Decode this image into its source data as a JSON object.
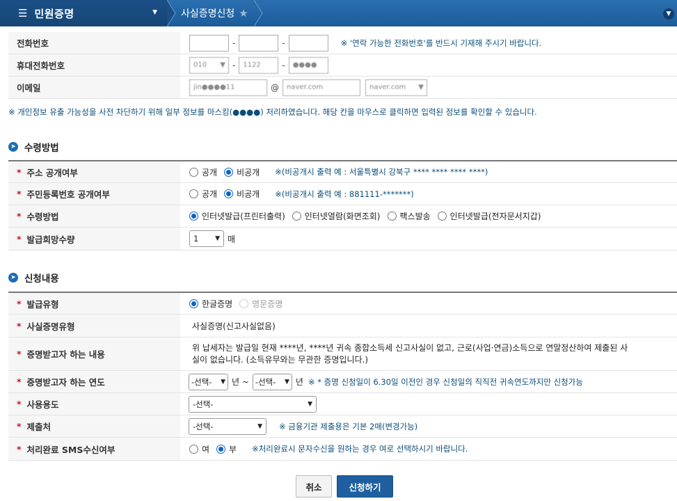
{
  "topbar": {
    "menu_icon": "hamburger-icon",
    "menu_title": "민원증명",
    "breadcrumb": "사실증명신청",
    "star_icon": "star-icon"
  },
  "contact": {
    "phone_label": "전화번호",
    "phone_note": "※ '연락 가능한 전화번호'를 반드시 기재해 주시기 바랍니다.",
    "mobile_label": "휴대전화번호",
    "mobile_prefix": "010",
    "mobile_middle": "1122",
    "mobile_last": "●●●●",
    "email_label": "이메일",
    "email_id": "jin●●●●11",
    "email_at": "@",
    "email_domain": "naver.com",
    "email_select": "naver.com"
  },
  "masking_note": "※ 개인정보 유출 가능성을 사전 차단하기 위해 일부 정보를 마스킹(●●●●) 처리하였습니다. 해당 칸을 마우스로 클릭하면 입력된 정보를 확인할 수 있습니다.",
  "receive": {
    "section_title": "수령방법",
    "addr_label": "주소 공개여부",
    "addr_public": "공개",
    "addr_private": "비공개",
    "addr_note": "※(비공개시 출력 예 : 서울특별시 강북구 **** **** **** ****)",
    "rrn_label": "주민등록번호 공개여부",
    "rrn_public": "공개",
    "rrn_private": "비공개",
    "rrn_note": "※(비공개시 출력 예 : 881111-*******)",
    "method_label": "수령방법",
    "methods": [
      "인터넷발급(프린터출력)",
      "인터넷열람(화면조회)",
      "팩스발송",
      "인터넷발급(전자문서지갑)"
    ],
    "qty_label": "발급희망수량",
    "qty_value": "1",
    "qty_unit": "매"
  },
  "request": {
    "section_title": "신청내용",
    "type_label": "발급유형",
    "type_korean": "한글증명",
    "type_english": "영문증명",
    "cert_type_label": "사실증명유형",
    "cert_type_value": "사실증명(신고사실없음)",
    "content_label": "증명받고자 하는 내용",
    "content_line1": "위 납세자는 발급일 현재 ****년, ****년 귀속 종합소득세 신고사실이 없고, 근로(사업·연금)소득으로 연말정산하여 제출된 사",
    "content_line2": "실이 없습니다. (소득유무와는 무관한 증명입니다.)",
    "year_label": "증명받고자 하는 연도",
    "year_from": "-선택-",
    "year_unit1": "년 ~",
    "year_to": "-선택-",
    "year_unit2": "년",
    "year_note": "※ * 증명 신청일이 6.30일 이전인 경우 신청일의 직직전 귀속연도까지만 신청가능",
    "usage_label": "사용용도",
    "usage_value": "-선택-",
    "submit_to_label": "제출처",
    "submit_to_value": "-선택-",
    "submit_to_note": "※ 금융기관 제출용은 기본 2매(변경가능)",
    "sms_label": "처리완료 SMS수신여부",
    "sms_yes": "여",
    "sms_no": "부",
    "sms_note": "※처리완료시 문자수신을 원하는 경우 여로 선택하시기 바랍니다."
  },
  "buttons": {
    "cancel": "취소",
    "submit": "신청하기"
  },
  "required_mark": "*"
}
